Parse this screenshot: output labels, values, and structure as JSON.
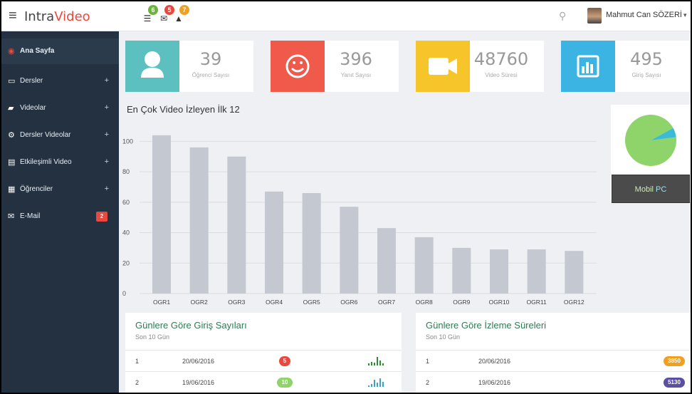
{
  "topbar": {
    "brand_prefix": "Intra",
    "brand_accent": "Video",
    "badges": [
      {
        "icon": "list-icon",
        "count": "6",
        "color": "#6bb33d"
      },
      {
        "icon": "envelope-icon",
        "count": "5",
        "color": "#e8483d"
      },
      {
        "icon": "bell-icon",
        "count": "7",
        "color": "#f0a020"
      }
    ],
    "user_name": "Mahmut Can SÖZERİ",
    "caret": "▾"
  },
  "sidebar": {
    "items": [
      {
        "label": "Ana Sayfa",
        "icon": "dashboard-icon",
        "plus": ""
      },
      {
        "label": "Dersler",
        "icon": "laptop-icon",
        "plus": "+"
      },
      {
        "label": "Videolar",
        "icon": "book-icon",
        "plus": "+"
      },
      {
        "label": "Dersler Videolar",
        "icon": "cogs-icon",
        "plus": "+"
      },
      {
        "label": "Etkileşimli Video",
        "icon": "list-alt-icon",
        "plus": "+"
      },
      {
        "label": "Öğrenciler",
        "icon": "grid-icon",
        "plus": "+"
      },
      {
        "label": "E-Mail",
        "icon": "envelope-icon",
        "plus": "",
        "badge": "2"
      }
    ]
  },
  "stats": [
    {
      "value": "39",
      "label": "Öğrenci Sayısı",
      "color": "#5cc0c0",
      "icon": "user-icon"
    },
    {
      "value": "396",
      "label": "Yanıt Sayısı",
      "color": "#f05a4b",
      "icon": "smiley-icon"
    },
    {
      "value": "48760",
      "label": "Video Süresi",
      "color": "#f5c52a",
      "icon": "video-camera-icon"
    },
    {
      "value": "495",
      "label": "Giriş Sayısı",
      "color": "#3bb3e3",
      "icon": "bar-chart-icon"
    }
  ],
  "chart_data": {
    "type": "bar",
    "title": "En Çok Video İzleyen İlk 12",
    "categories": [
      "OGR1",
      "OGR2",
      "OGR3",
      "OGR4",
      "OGR5",
      "OGR6",
      "OGR7",
      "OGR8",
      "OGR9",
      "OGR10",
      "OGR11",
      "OGR12"
    ],
    "values": [
      104,
      96,
      90,
      67,
      66,
      57,
      43,
      37,
      30,
      29,
      29,
      28
    ],
    "ylim": [
      0,
      110
    ],
    "yticks": [
      "0",
      "20",
      "40",
      "60",
      "80",
      "100"
    ],
    "bar_color": "#c4c8d0",
    "grid": true
  },
  "pie": {
    "chart_data": {
      "type": "pie",
      "labels": [
        "Mobil",
        "PC"
      ],
      "values": [
        94,
        6
      ],
      "colors": [
        "#8fd46a",
        "#3cbcd4"
      ]
    },
    "legend_mobil": "Mobil",
    "legend_pc": "PC"
  },
  "logins": {
    "title": "Günlere Göre Giriş Sayıları",
    "subtitle": "Son 10 Gün",
    "rows": [
      {
        "index": "1",
        "date": "20/06/2016",
        "value": "5",
        "color": "#e8483d"
      },
      {
        "index": "2",
        "date": "19/06/2016",
        "value": "10",
        "color": "#8fd46a"
      }
    ]
  },
  "watch": {
    "title": "Günlere Göre İzleme Süreleri",
    "subtitle": "Son 10 Gün",
    "rows": [
      {
        "index": "1",
        "date": "20/06/2016",
        "value": "3850",
        "color": "#f0a020"
      },
      {
        "index": "2",
        "date": "19/06/2016",
        "value": "5130",
        "color": "#5a4fa0"
      }
    ]
  }
}
